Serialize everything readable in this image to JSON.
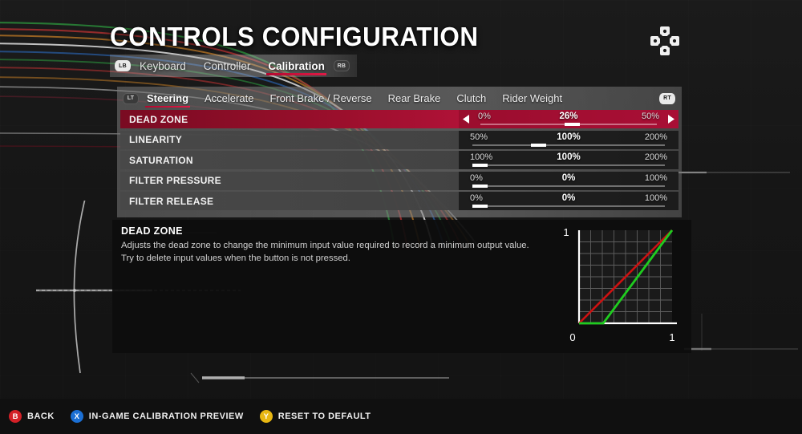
{
  "header": {
    "title": "CONTROLS CONFIGURATION",
    "dpad_icon": "dpad-icon"
  },
  "tabs": {
    "left_bumper": "LB",
    "right_bumper": "RB",
    "items": [
      {
        "label": "Keyboard",
        "active": false
      },
      {
        "label": "Controller",
        "active": false
      },
      {
        "label": "Calibration",
        "active": true
      }
    ]
  },
  "subtabs": {
    "left_trigger": "LT",
    "right_trigger": "RT",
    "items": [
      {
        "label": "Steering",
        "active": true
      },
      {
        "label": "Accelerate",
        "active": false
      },
      {
        "label": "Front Brake / Reverse",
        "active": false
      },
      {
        "label": "Rear Brake",
        "active": false
      },
      {
        "label": "Clutch",
        "active": false
      },
      {
        "label": "Rider Weight",
        "active": false
      }
    ]
  },
  "settings": {
    "rows": [
      {
        "label": "DEAD ZONE",
        "min": "0%",
        "value": "26%",
        "max": "50%",
        "fill": 52,
        "selected": true,
        "arrows": true
      },
      {
        "label": "LINEARITY",
        "min": "50%",
        "value": "100%",
        "max": "200%",
        "fill": 33,
        "selected": false,
        "arrows": false
      },
      {
        "label": "SATURATION",
        "min": "100%",
        "value": "100%",
        "max": "200%",
        "fill": 0,
        "selected": false,
        "arrows": false
      },
      {
        "label": "FILTER PRESSURE",
        "min": "0%",
        "value": "0%",
        "max": "100%",
        "fill": 0,
        "selected": false,
        "arrows": false
      },
      {
        "label": "FILTER RELEASE",
        "min": "0%",
        "value": "0%",
        "max": "100%",
        "fill": 0,
        "selected": false,
        "arrows": false
      }
    ]
  },
  "description": {
    "title": "DEAD ZONE",
    "line1": "Adjusts the dead zone to change the minimum input value required to record a minimum output value.",
    "line2": "Try to delete input values when the button is not pressed."
  },
  "graph": {
    "y_top_label": "1",
    "x_left_label": "0",
    "x_right_label": "1",
    "reference_color": "#cc1111",
    "curve_color": "#1fcc1f",
    "dead_zone": 0.26,
    "grid_divisions": 8
  },
  "footer": {
    "buttons": [
      {
        "glyph": "B",
        "label": "BACK",
        "color": "#d42027"
      },
      {
        "glyph": "X",
        "label": "IN-GAME CALIBRATION PREVIEW",
        "color": "#1b6fd4"
      },
      {
        "glyph": "Y",
        "label": "RESET TO DEFAULT",
        "color": "#e8b712"
      }
    ]
  }
}
